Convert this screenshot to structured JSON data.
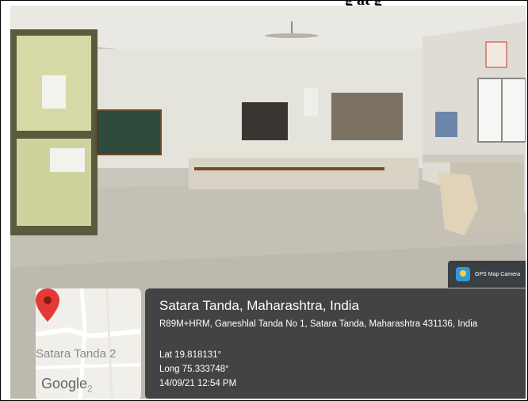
{
  "caption_fragment": "g at g",
  "badge": {
    "icon": "map-camera-icon",
    "label": "GPS Map Camera"
  },
  "location": {
    "place": "Satara Tanda, Maharashtra, India",
    "address": "R89M+HRM, Ganeshlal Tanda No 1, Satara Tanda, Maharashtra 431136, India",
    "lat": "Lat 19.818131°",
    "long": "Long 75.333748°",
    "datetime": "14/09/21 12:54 PM"
  },
  "map": {
    "label": "Satara Tanda 2",
    "logo": "Google",
    "logo_suffix": "2",
    "pin_color": "#e53935"
  }
}
